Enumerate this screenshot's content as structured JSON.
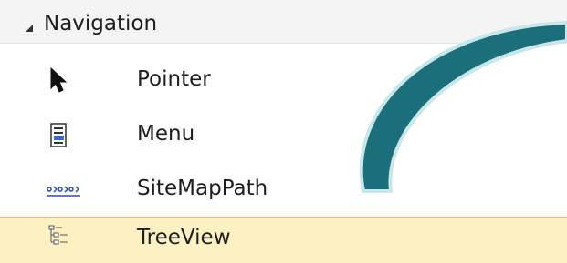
{
  "toolbox": {
    "group": {
      "title": "Navigation",
      "expand_icon": "collapse-triangle-icon"
    },
    "items": [
      {
        "label": "Pointer",
        "icon": "pointer-icon",
        "selected": false
      },
      {
        "label": "Menu",
        "icon": "menu-control-icon",
        "selected": false
      },
      {
        "label": "SiteMapPath",
        "icon": "sitemappath-icon",
        "selected": false
      },
      {
        "label": "TreeView",
        "icon": "treeview-icon",
        "selected": true
      }
    ]
  },
  "colors": {
    "header_bg": "#f4f4f4",
    "selected_bg": "#fdf0c3",
    "selected_border": "#e8c46a",
    "arrow_fill": "#1a6f7a",
    "arrow_outline": "#c9e7ea",
    "menu_icon_accent": "#3a66d8"
  }
}
